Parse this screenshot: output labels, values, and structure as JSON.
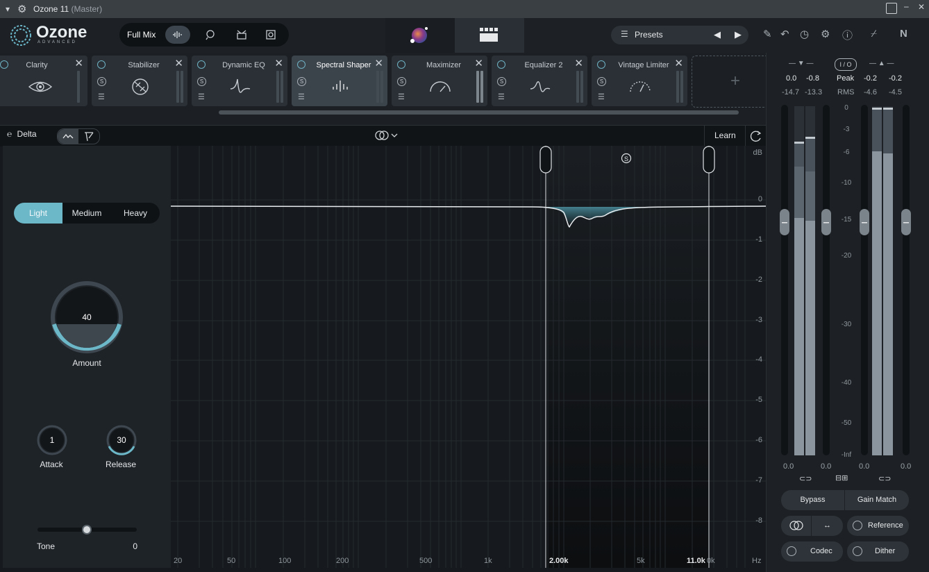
{
  "titlebar": {
    "app": "Ozone 11",
    "context": "(Master)"
  },
  "header": {
    "logo_name": "Ozone",
    "logo_sub": "ADVANCED",
    "fullmix_label": "Full Mix",
    "presets_label": "Presets"
  },
  "modules": [
    {
      "name": "Clarity"
    },
    {
      "name": "Stabilizer"
    },
    {
      "name": "Dynamic EQ"
    },
    {
      "name": "Spectral Shaper"
    },
    {
      "name": "Maximizer"
    },
    {
      "name": "Equalizer 2"
    },
    {
      "name": "Vintage Limiter"
    }
  ],
  "module_button_s": "S",
  "add_module_glyph": "+",
  "toolbar": {
    "delta_label": "Delta",
    "learn_label": "Learn"
  },
  "modes": {
    "items": [
      "Light",
      "Medium",
      "Heavy"
    ],
    "selected": "Light"
  },
  "amount": {
    "value": "40",
    "label": "Amount",
    "level": 0.4
  },
  "attack": {
    "value": "1",
    "label": "Attack"
  },
  "release": {
    "value": "30",
    "label": "Release"
  },
  "tone": {
    "label": "Tone",
    "value": "0",
    "level": 0.5
  },
  "graph": {
    "y_unit": "dB",
    "y_labels": [
      "0",
      "-1",
      "-2",
      "-3",
      "-4",
      "-5",
      "-6",
      "-7",
      "-8"
    ],
    "x_labels": [
      "20",
      "50",
      "100",
      "200",
      "500",
      "1k",
      "2.00k",
      "5k",
      "11.0k",
      "0k",
      "Hz"
    ],
    "solo_badge": "S",
    "band_low": "2.00k",
    "band_high": "11.0k"
  },
  "meters": {
    "in_peak_l": "0.0",
    "in_peak_r": "-0.8",
    "in_rms_l": "-14.7",
    "in_rms_r": "-13.3",
    "out_peak_l": "-0.2",
    "out_peak_r": "-0.2",
    "out_rms_l": "-4.6",
    "out_rms_r": "-4.5",
    "io_label": "I / O",
    "peak_label": "Peak",
    "rms_label": "RMS",
    "scale": [
      "0",
      "-3",
      "-6",
      "-10",
      "-15",
      "-20",
      "-30",
      "-40",
      "-50",
      "-Inf"
    ],
    "gain_in_l": "0.0",
    "gain_in_r": "0.0",
    "gain_out_l": "0.0",
    "gain_out_r": "0.0"
  },
  "buttons": {
    "bypass": "Bypass",
    "gain_match": "Gain Match",
    "reference": "Reference",
    "codec": "Codec",
    "dither": "Dither"
  },
  "colors": {
    "accent": "#6cb8c9",
    "background": "#16191d"
  }
}
